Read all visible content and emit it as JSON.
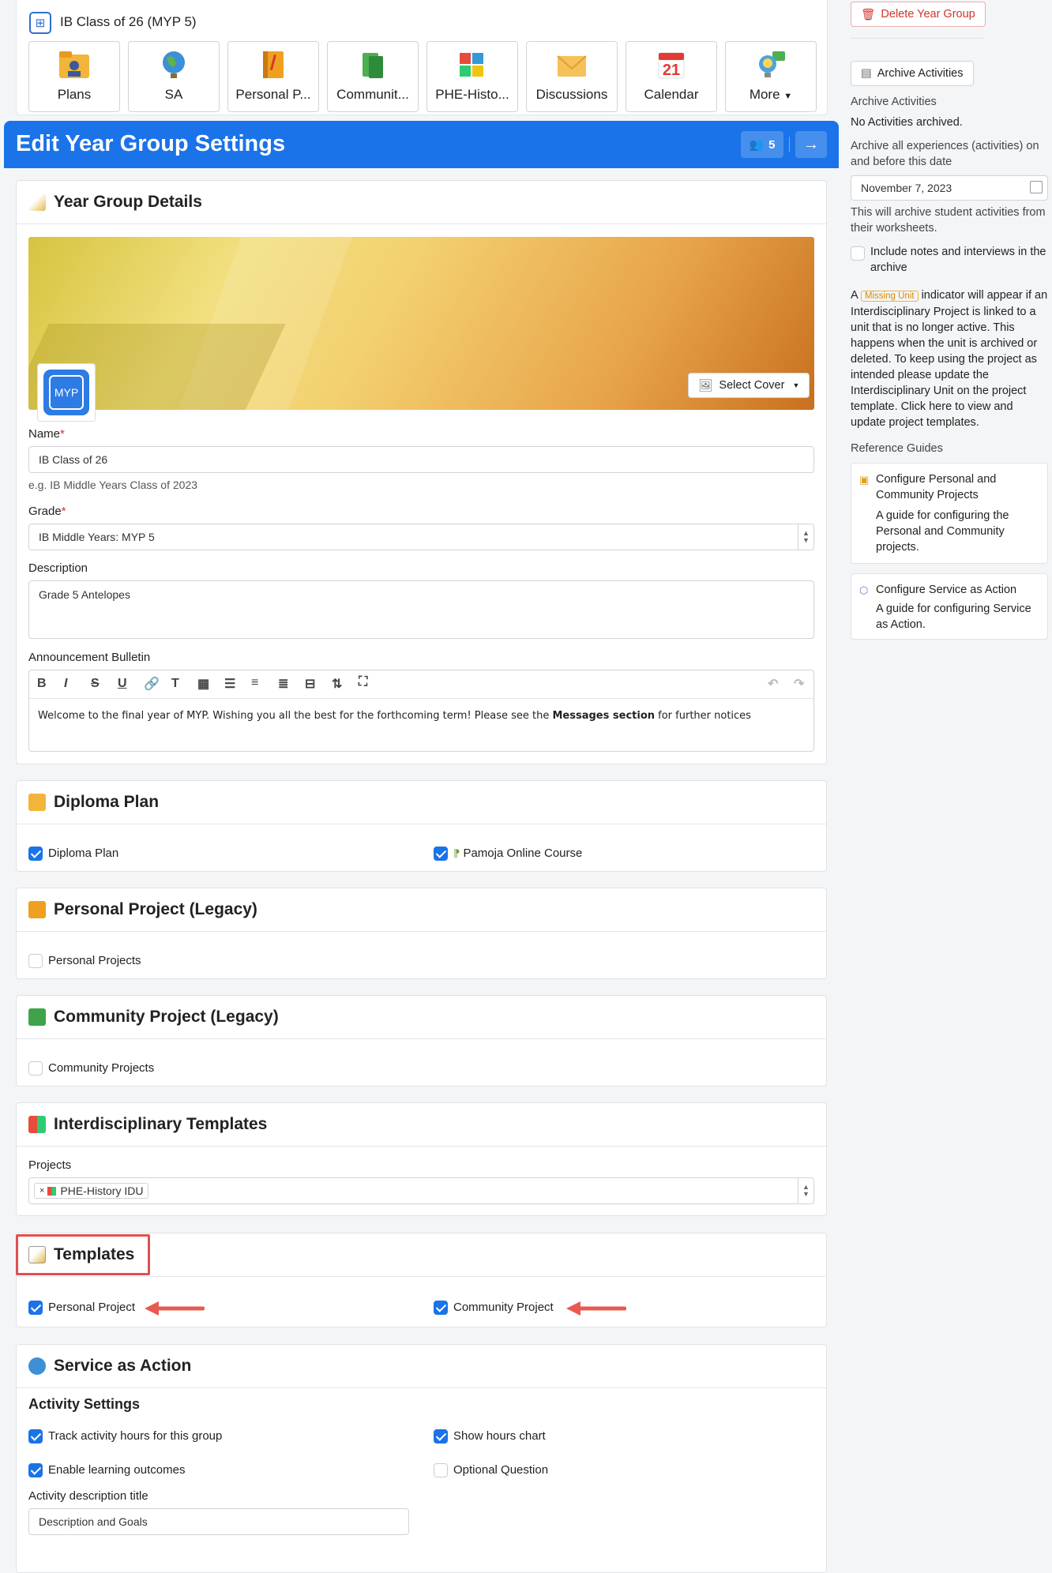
{
  "header": {
    "title": "IB Class of 26 (MYP 5)"
  },
  "tiles": [
    {
      "label": "Plans",
      "icon": "plans-icon"
    },
    {
      "label": "SA",
      "icon": "globe-icon"
    },
    {
      "label": "Personal P...",
      "icon": "notebook-icon"
    },
    {
      "label": "Communit...",
      "icon": "books-icon"
    },
    {
      "label": "PHE-Histo...",
      "icon": "puzzle-icon"
    },
    {
      "label": "Discussions",
      "icon": "envelope-icon"
    },
    {
      "label": "Calendar",
      "icon": "calendar-icon",
      "day": "21"
    },
    {
      "label": "More",
      "icon": "lightbulb-icon"
    }
  ],
  "settings": {
    "title": "Edit Year Group Settings",
    "member_count": "5"
  },
  "details": {
    "title": "Year Group Details",
    "logo_text": "MYP",
    "select_cover": "Select Cover",
    "name_label": "Name",
    "name_value": "IB Class of 26",
    "name_hint": "e.g. IB Middle Years Class of 2023",
    "grade_label": "Grade",
    "grade_value": "IB Middle Years: MYP 5",
    "desc_label": "Description",
    "desc_value": "Grade 5 Antelopes",
    "bulletin_label": "Announcement Bulletin",
    "bulletin_pre": "Welcome to the final year of MYP. Wishing you all the best for the forthcoming term! Please see the ",
    "bulletin_bold": "Messages section",
    "bulletin_post": " for further notices"
  },
  "diploma": {
    "title": "Diploma Plan",
    "opt1": "Diploma Plan",
    "opt2": "Pamoja Online Course"
  },
  "personal": {
    "title": "Personal Project (Legacy)",
    "opt1": "Personal Projects"
  },
  "community": {
    "title": "Community Project (Legacy)",
    "opt1": "Community Projects"
  },
  "interdisciplinary": {
    "title": "Interdisciplinary Templates",
    "projects_label": "Projects",
    "tag": "PHE-History IDU"
  },
  "templates": {
    "title": "Templates",
    "opt1": "Personal Project",
    "opt2": "Community Project"
  },
  "service": {
    "title": "Service as Action",
    "subtitle": "Activity Settings",
    "opt1": "Track activity hours for this group",
    "opt2": "Show hours chart",
    "opt3": "Enable learning outcomes",
    "opt4": "Optional Question",
    "desc_title_label": "Activity description title",
    "desc_title_value": "Description and Goals"
  },
  "sidebar": {
    "delete_btn": "Delete Year Group",
    "archive_btn": "Archive Activities",
    "archive_heading": "Archive Activities",
    "no_archived": "No Activities archived.",
    "archive_desc": "Archive all experiences (activities) on and before this date",
    "date": "November 7, 2023",
    "archive_note": "This will archive student activities from their worksheets.",
    "include_notes": "Include notes and interviews in the archive",
    "missing_pre": "A",
    "missing_badge": "Missing Unit",
    "missing_post": "indicator will appear if an Interdisciplinary Project is linked to a unit that is no longer active. This happens when the unit is archived or deleted. To keep using the project as intended please update the Interdisciplinary Unit on the project template. Click here to view and update project templates.",
    "ref_heading": "Reference Guides",
    "guide1_title": "Configure Personal and Community Projects",
    "guide1_desc": "A guide for configuring the Personal and Community projects.",
    "guide2_title": "Configure Service as Action",
    "guide2_desc": "A guide for configuring Service as Action."
  }
}
